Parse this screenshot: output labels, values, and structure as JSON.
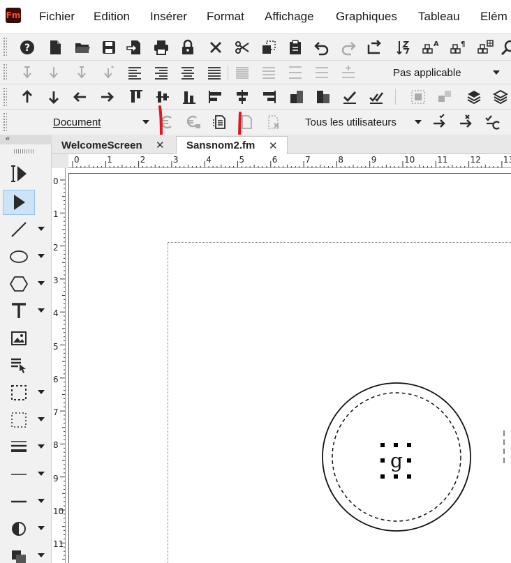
{
  "app": {
    "logo_text": "Fm"
  },
  "menu": {
    "items": [
      "Fichier",
      "Edition",
      "Insérer",
      "Format",
      "Affichage",
      "Graphiques",
      "Tableau",
      "Elém"
    ]
  },
  "toolbar_format": {
    "paragraph_tag_value": "Pas applicable"
  },
  "toolbar_track": {
    "view_value": "Document",
    "users_value": "Tous les utilisateurs"
  },
  "palette": {
    "header": "«"
  },
  "tabs": [
    {
      "label": "WelcomeScreen",
      "close": "✕"
    },
    {
      "label": "Sansnom2.fm",
      "close": "✕"
    }
  ],
  "ruler": {
    "horizontal": [
      "0",
      "1",
      "2",
      "3",
      "4",
      "5",
      "6",
      "7",
      "8",
      "9",
      "10",
      "11",
      "12",
      "13"
    ],
    "vertical": [
      "0",
      "1",
      "2",
      "3",
      "4",
      "5",
      "6",
      "7",
      "8",
      "9",
      "10",
      "11"
    ]
  },
  "canvas": {
    "selected_text": "g"
  },
  "colors": {
    "annotation_red": "#e0161e",
    "selection_blue": "#cde3f7",
    "toolbar_bg": "#f1f1f1"
  }
}
